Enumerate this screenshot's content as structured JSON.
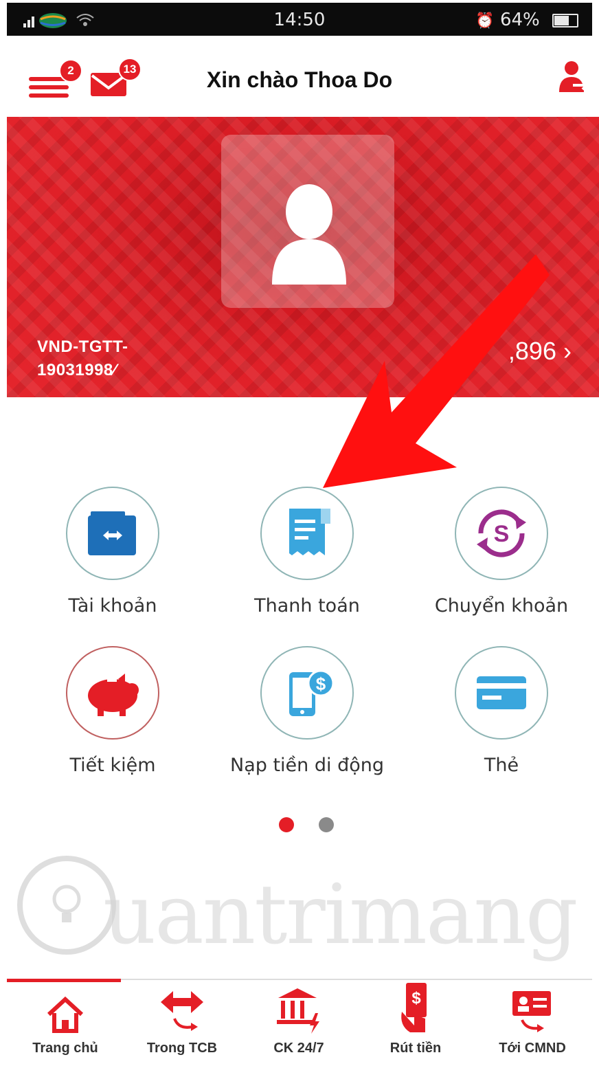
{
  "status_bar": {
    "time": "14:50",
    "battery": "64%"
  },
  "header": {
    "greeting": "Xin chào Thoa Do",
    "menu_badge": "2",
    "mail_badge": "13"
  },
  "banner": {
    "account_line1": "VND-TGTT-",
    "account_line2": "19031998⁄",
    "balance": ",896",
    "balance_chevron": "›"
  },
  "menu": [
    {
      "label": "Tài khoản",
      "icon": "wallet-icon"
    },
    {
      "label": "Thanh toán",
      "icon": "bill-icon"
    },
    {
      "label": "Chuyển khoản",
      "icon": "transfer-dollar-icon"
    },
    {
      "label": "Tiết kiệm",
      "icon": "piggy-bank-icon"
    },
    {
      "label": "Nạp tiền di động",
      "icon": "mobile-topup-icon"
    },
    {
      "label": "Thẻ",
      "icon": "card-icon"
    }
  ],
  "pagination": {
    "active": 1,
    "total": 2
  },
  "watermark": {
    "text": "uantrimang"
  },
  "bottom_nav": [
    {
      "label": "Trang chủ",
      "icon": "home-icon",
      "active": true
    },
    {
      "label": "Trong TCB",
      "icon": "internal-transfer-icon",
      "active": false
    },
    {
      "label": "CK 24/7",
      "icon": "bank-fast-icon",
      "active": false
    },
    {
      "label": "Rút tiền",
      "icon": "withdraw-icon",
      "active": false
    },
    {
      "label": "Tới CMND",
      "icon": "id-card-icon",
      "active": false
    }
  ],
  "colors": {
    "brand_red": "#e41e26",
    "blue": "#1e6fb8",
    "light_blue": "#3aa6dd",
    "purple": "#9b2d8c"
  }
}
